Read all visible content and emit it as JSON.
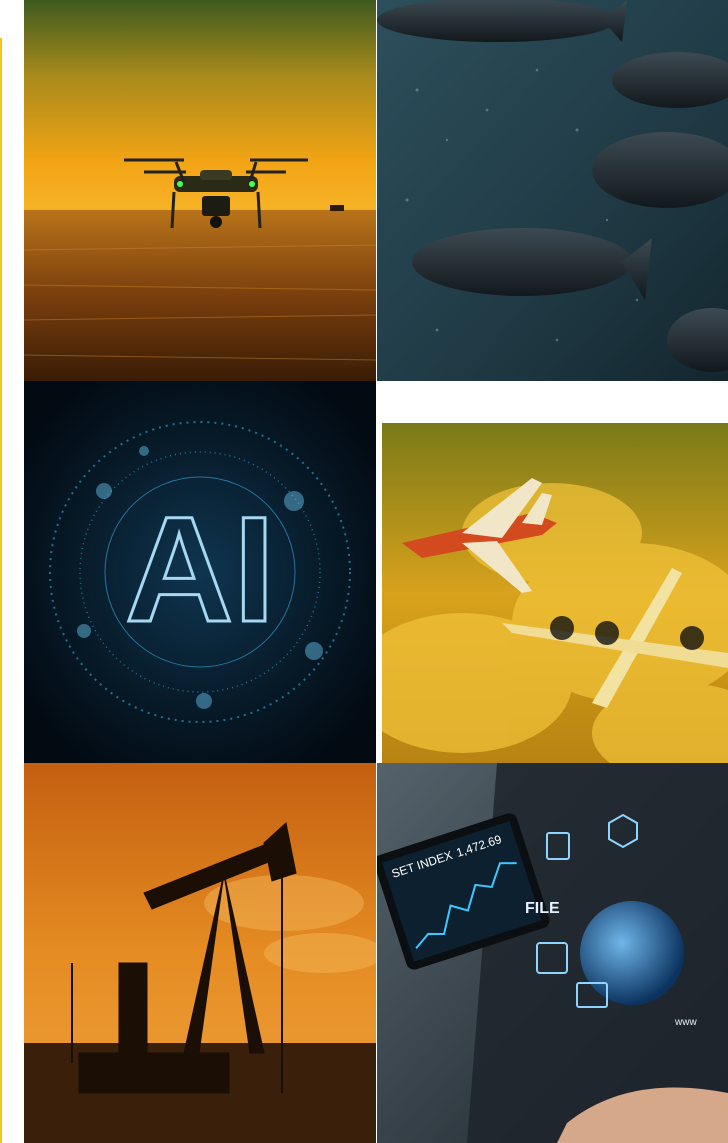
{
  "colors": {
    "accent": "#f5c518",
    "gold": "#e7a21a",
    "teal_dark": "#1f3a45",
    "ai_blue": "#3aa9e0",
    "orange": "#d9801d",
    "tablet_blue": "#1a6fb5"
  },
  "tiles": {
    "drone": {
      "icon": "drone-field-image"
    },
    "salmon": {
      "icon": "salmon-school-image"
    },
    "ai": {
      "label": "AI",
      "icon": "ai-circuit-image"
    },
    "planes": {
      "icon": "aircraft-clouds-image"
    },
    "oil": {
      "icon": "oil-pumpjack-image"
    },
    "tablet": {
      "index_label": "SET INDEX",
      "index_value": "1,472.69",
      "file_label": "FILE",
      "www_label": "www"
    }
  }
}
